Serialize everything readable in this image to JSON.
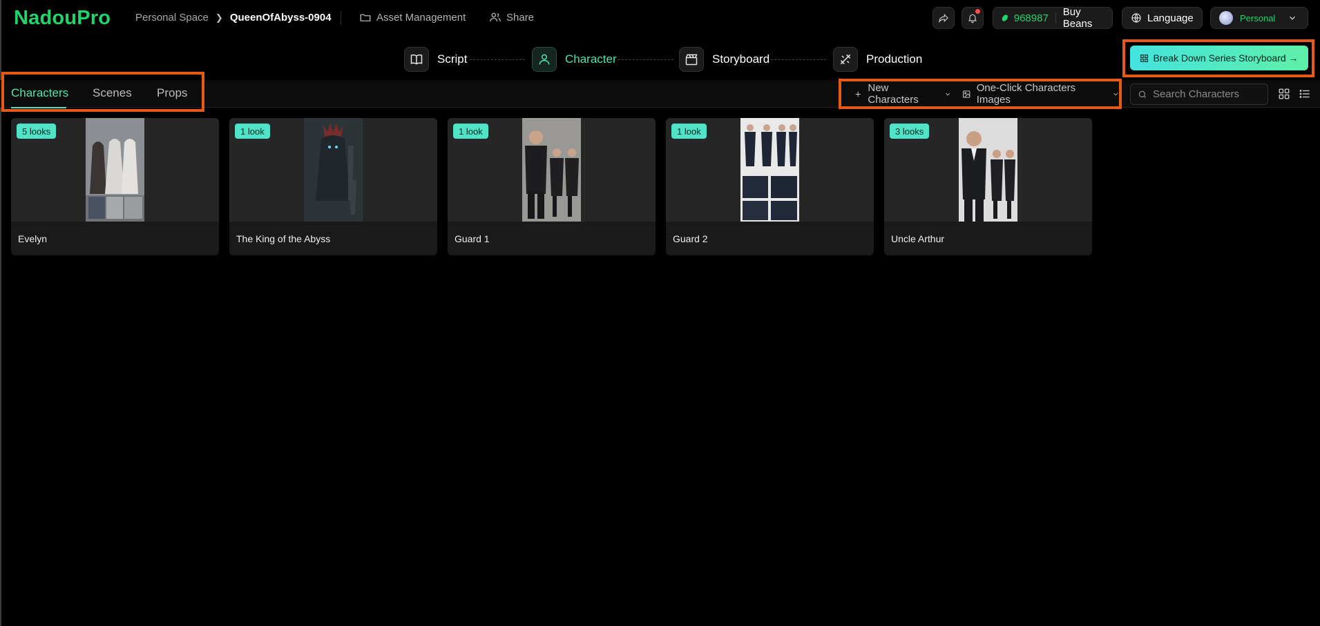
{
  "header": {
    "logo": "NadouPro",
    "breadcrumb": {
      "root": "Personal Space",
      "current": "QueenOfAbyss-0904"
    },
    "asset_management": "Asset Management",
    "share": "Share",
    "beans": {
      "count": "968987",
      "buy": "Buy Beans"
    },
    "language": "Language",
    "account": "Personal"
  },
  "steps": [
    {
      "label": "Script",
      "icon": "book-icon"
    },
    {
      "label": "Character",
      "icon": "person-icon",
      "active": true
    },
    {
      "label": "Storyboard",
      "icon": "clapperboard-icon"
    },
    {
      "label": "Production",
      "icon": "tools-icon"
    }
  ],
  "primary_action": "Break Down Series Storyboard →",
  "tabs": [
    "Characters",
    "Scenes",
    "Props"
  ],
  "toolbar": {
    "new_characters": "New Characters",
    "one_click_images": "One-Click Characters Images",
    "search_placeholder": "Search Characters"
  },
  "characters": [
    {
      "name": "Evelyn",
      "looks": "5 looks"
    },
    {
      "name": "The King of the Abyss",
      "looks": "1 look"
    },
    {
      "name": "Guard 1",
      "looks": "1 look"
    },
    {
      "name": "Guard 2",
      "looks": "1 look"
    },
    {
      "name": "Uncle Arthur",
      "looks": "3 looks"
    }
  ],
  "colors": {
    "brand_green": "#20d36a",
    "accent_teal": "#4fe3b3",
    "highlight_orange": "#e65a14"
  }
}
